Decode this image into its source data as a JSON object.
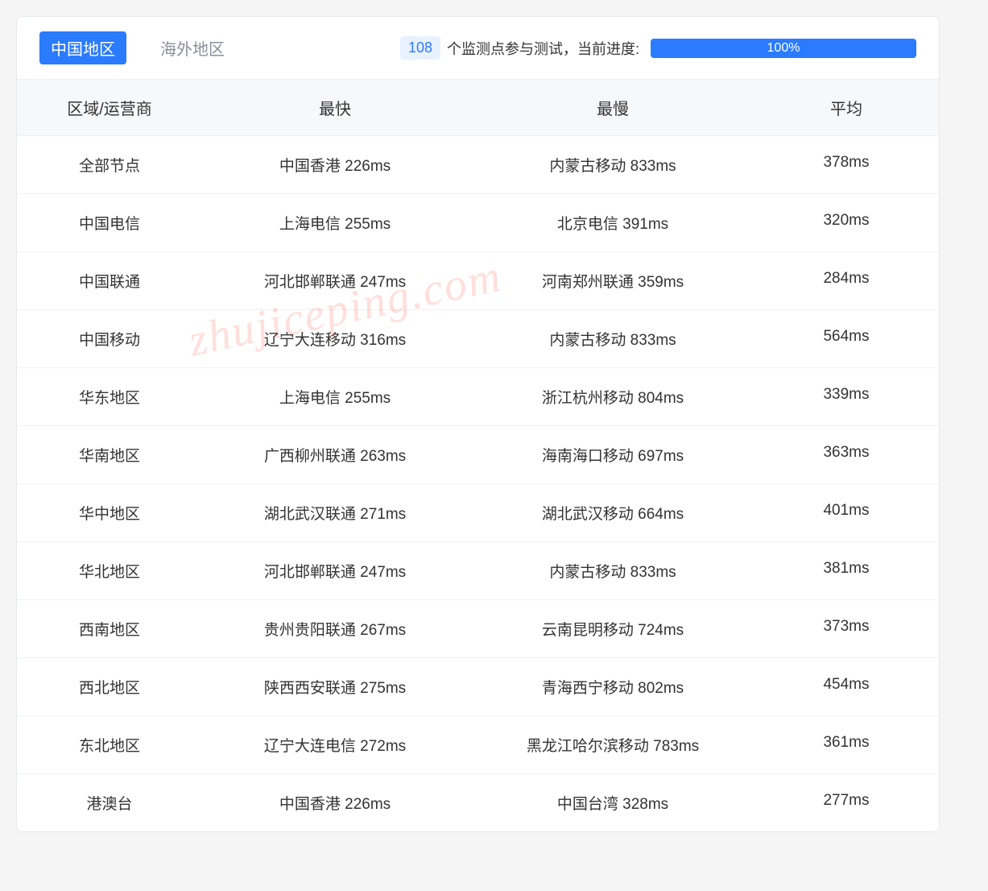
{
  "tabs": {
    "china": "中国地区",
    "overseas": "海外地区"
  },
  "status": {
    "count": "108",
    "text": "个监测点参与测试，当前进度:",
    "progress": "100%"
  },
  "table": {
    "headers": {
      "region": "区域/运营商",
      "fastest": "最快",
      "slowest": "最慢",
      "average": "平均"
    },
    "rows": [
      {
        "region": "全部节点",
        "fastest": "中国香港 226ms",
        "slowest": "内蒙古移动 833ms",
        "average": "378ms"
      },
      {
        "region": "中国电信",
        "fastest": "上海电信 255ms",
        "slowest": "北京电信 391ms",
        "average": "320ms"
      },
      {
        "region": "中国联通",
        "fastest": "河北邯郸联通 247ms",
        "slowest": "河南郑州联通 359ms",
        "average": "284ms"
      },
      {
        "region": "中国移动",
        "fastest": "辽宁大连移动 316ms",
        "slowest": "内蒙古移动 833ms",
        "average": "564ms"
      },
      {
        "region": "华东地区",
        "fastest": "上海电信 255ms",
        "slowest": "浙江杭州移动 804ms",
        "average": "339ms"
      },
      {
        "region": "华南地区",
        "fastest": "广西柳州联通 263ms",
        "slowest": "海南海口移动 697ms",
        "average": "363ms"
      },
      {
        "region": "华中地区",
        "fastest": "湖北武汉联通 271ms",
        "slowest": "湖北武汉移动 664ms",
        "average": "401ms"
      },
      {
        "region": "华北地区",
        "fastest": "河北邯郸联通 247ms",
        "slowest": "内蒙古移动 833ms",
        "average": "381ms"
      },
      {
        "region": "西南地区",
        "fastest": "贵州贵阳联通 267ms",
        "slowest": "云南昆明移动 724ms",
        "average": "373ms"
      },
      {
        "region": "西北地区",
        "fastest": "陕西西安联通 275ms",
        "slowest": "青海西宁移动 802ms",
        "average": "454ms"
      },
      {
        "region": "东北地区",
        "fastest": "辽宁大连电信 272ms",
        "slowest": "黑龙江哈尔滨移动 783ms",
        "average": "361ms"
      },
      {
        "region": "港澳台",
        "fastest": "中国香港 226ms",
        "slowest": "中国台湾 328ms",
        "average": "277ms"
      }
    ]
  },
  "watermark": "zhujiceping.com"
}
